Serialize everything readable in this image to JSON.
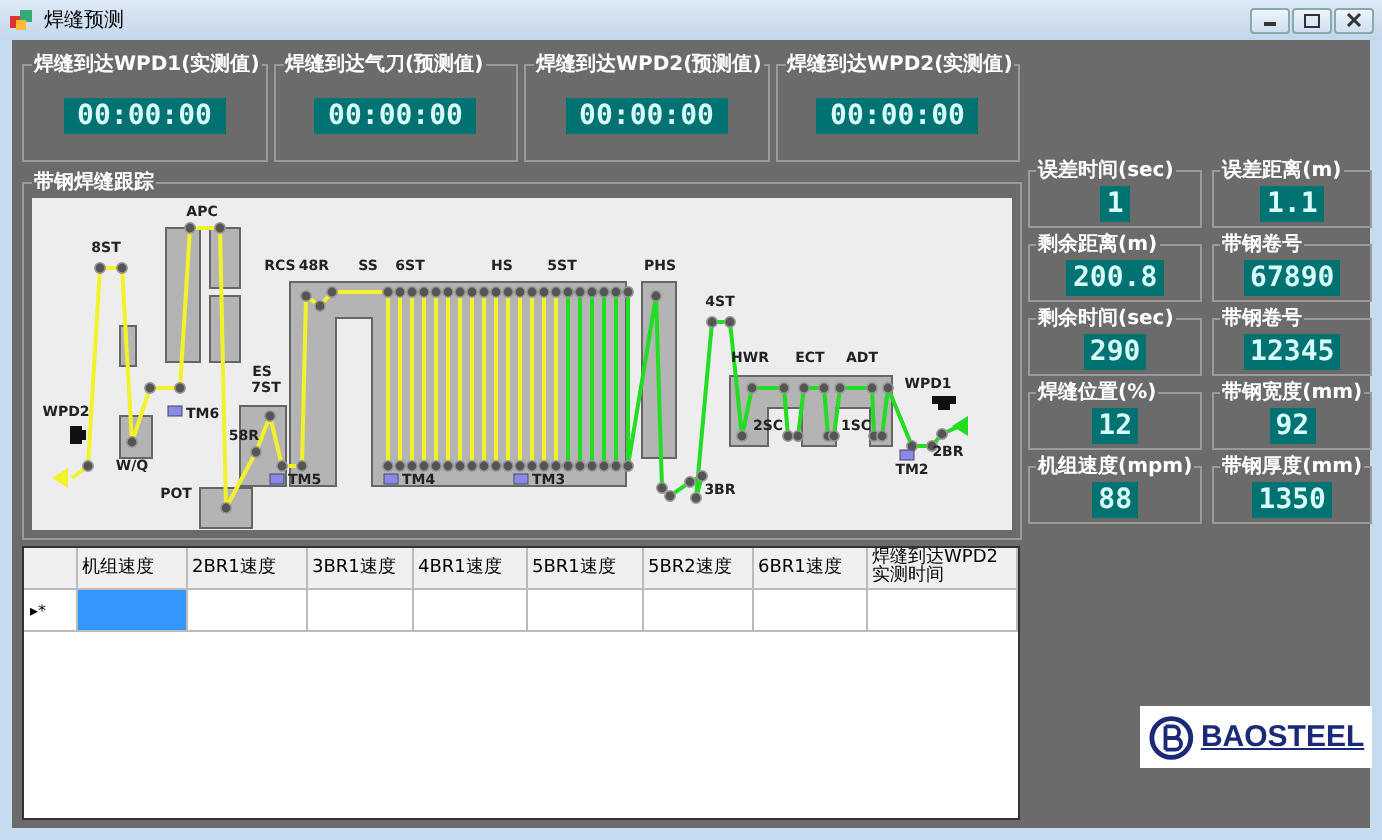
{
  "window": {
    "title": "焊缝预测"
  },
  "timers": [
    {
      "label": "焊缝到达WPD1(实测值)",
      "value": "00:00:00"
    },
    {
      "label": "焊缝到达气刀(预测值)",
      "value": "00:00:00"
    },
    {
      "label": "焊缝到达WPD2(预测值)",
      "value": "00:00:00"
    },
    {
      "label": "焊缝到达WPD2(实测值)",
      "value": "00:00:00"
    }
  ],
  "diagram": {
    "title": "带钢焊缝跟踪",
    "labels": [
      "8ST",
      "APC",
      "RCS",
      "48R",
      "SS",
      "6ST",
      "HS",
      "5ST",
      "PHS",
      "4ST",
      "HWR",
      "ECT",
      "ADT",
      "WPD1",
      "ES",
      "7ST",
      "58R",
      "WPD2",
      "TM6",
      "W/Q",
      "TM5",
      "TM4",
      "TM3",
      "POT",
      "3BR",
      "2SC",
      "1SC",
      "2BR",
      "TM2"
    ]
  },
  "readouts": [
    {
      "label": "误差时间(sec)",
      "value": "1"
    },
    {
      "label": "误差距离(m)",
      "value": "1.1"
    },
    {
      "label": "剩余距离(m)",
      "value": "200.8"
    },
    {
      "label": "带钢卷号",
      "value": "67890"
    },
    {
      "label": "剩余时间(sec)",
      "value": "290"
    },
    {
      "label": "带钢卷号",
      "value": "12345"
    },
    {
      "label": "焊缝位置(%)",
      "value": "12"
    },
    {
      "label": "带钢宽度(mm)",
      "value": "92"
    },
    {
      "label": "机组速度(mpm)",
      "value": "88"
    },
    {
      "label": "带钢厚度(mm)",
      "value": "1350"
    }
  ],
  "table": {
    "columns": [
      "机组速度",
      "2BR1速度",
      "3BR1速度",
      "4BR1速度",
      "5BR1速度",
      "5BR2速度",
      "6BR1速度",
      "焊缝到达WPD2实测时间"
    ],
    "new_row": {
      "marker": "▸*",
      "cells": [
        {
          "selected": true
        },
        {
          "selected": false
        },
        {
          "selected": false
        },
        {
          "selected": false
        },
        {
          "selected": false
        },
        {
          "selected": false
        },
        {
          "selected": false
        },
        {
          "selected": false
        }
      ]
    }
  },
  "logo": {
    "text": "BAOSTEEL"
  }
}
